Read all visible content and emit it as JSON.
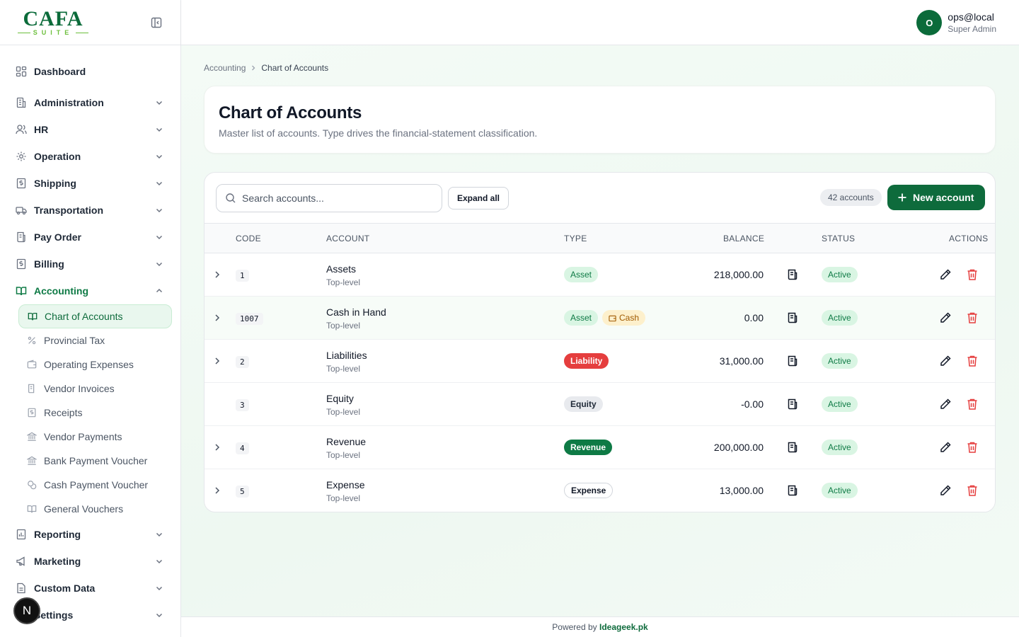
{
  "brand": {
    "logo_main": "CAFA",
    "logo_sub": "SUITE"
  },
  "header": {
    "user_initial": "O",
    "user_name": "ops@local",
    "user_role": "Super Admin"
  },
  "sidebar": {
    "dashboard": "Dashboard",
    "groups": [
      "Administration",
      "HR",
      "Operation",
      "Shipping",
      "Transportation",
      "Pay Order",
      "Billing"
    ],
    "accounting": "Accounting",
    "accounting_items": [
      "Chart of Accounts",
      "Provincial Tax",
      "Operating Expenses",
      "Vendor Invoices",
      "Receipts",
      "Vendor Payments",
      "Bank Payment Voucher",
      "Cash Payment Voucher",
      "General Vouchers"
    ],
    "groups_after": [
      "Reporting",
      "Marketing",
      "Custom Data",
      "Settings"
    ]
  },
  "overlay_badge": "N",
  "breadcrumb": {
    "parent": "Accounting",
    "current": "Chart of Accounts"
  },
  "page": {
    "title": "Chart of Accounts",
    "subtitle": "Master list of accounts. Type drives the financial-statement classification."
  },
  "toolbar": {
    "search_placeholder": "Search accounts...",
    "expand_label": "Expand all",
    "count_label": "42 accounts",
    "new_label": "New account"
  },
  "columns": {
    "code": "CODE",
    "account": "ACCOUNT",
    "type": "TYPE",
    "balance": "BALANCE",
    "status": "STATUS",
    "actions": "ACTIONS"
  },
  "rows": [
    {
      "code": "1",
      "name": "Assets",
      "level": "Top-level",
      "type": "Asset",
      "extra_tag": "",
      "balance": "218,000.00",
      "status": "Active"
    },
    {
      "code": "1007",
      "name": "Cash in Hand",
      "level": "Top-level",
      "type": "Asset",
      "extra_tag": "Cash",
      "balance": "0.00",
      "status": "Active"
    },
    {
      "code": "2",
      "name": "Liabilities",
      "level": "Top-level",
      "type": "Liability",
      "extra_tag": "",
      "balance": "31,000.00",
      "status": "Active"
    },
    {
      "code": "3",
      "name": "Equity",
      "level": "Top-level",
      "type": "Equity",
      "extra_tag": "",
      "balance": "-0.00",
      "status": "Active"
    },
    {
      "code": "4",
      "name": "Revenue",
      "level": "Top-level",
      "type": "Revenue",
      "extra_tag": "",
      "balance": "200,000.00",
      "status": "Active"
    },
    {
      "code": "5",
      "name": "Expense",
      "level": "Top-level",
      "type": "Expense",
      "extra_tag": "",
      "balance": "13,000.00",
      "status": "Active"
    }
  ],
  "footer": {
    "prefix": "Powered by",
    "brand": "Ideageek.pk"
  },
  "colors": {
    "brand_green": "#0e6b3c",
    "danger": "#e53e3e",
    "active_bg": "#d9f5e3"
  }
}
